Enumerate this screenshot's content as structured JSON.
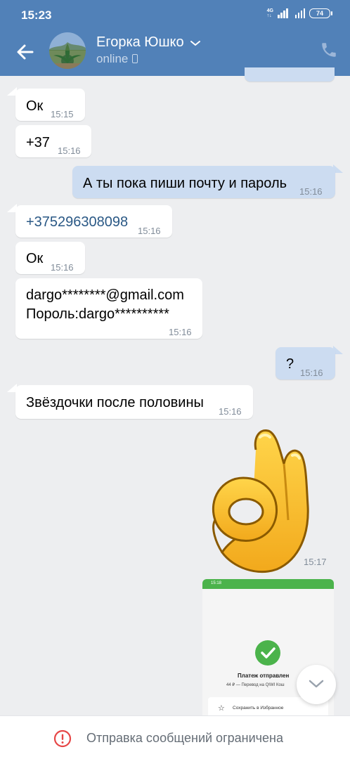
{
  "status_bar": {
    "time": "15:23",
    "network": "4G",
    "battery": "74"
  },
  "header": {
    "contact_name": "Егорка Юшко",
    "status": "online",
    "back_icon": "arrow-left-icon",
    "call_icon": "phone-icon",
    "dropdown_icon": "chevron-down-icon",
    "bg_color": "#5181b8"
  },
  "messages": [
    {
      "dir": "in",
      "text": "Ок",
      "time": "15:15"
    },
    {
      "dir": "in",
      "text": "+37",
      "time": "15:16"
    },
    {
      "dir": "out",
      "text": "А ты пока пиши почту и пароль",
      "time": "15:16"
    },
    {
      "dir": "in",
      "text": "+375296308098",
      "time": "15:16",
      "link": true
    },
    {
      "dir": "in",
      "text": "Ок",
      "time": "15:16"
    },
    {
      "dir": "in",
      "line1": "dargo********@gmail.com",
      "line2": "Пороль:dargo**********",
      "time": "15:16"
    },
    {
      "dir": "out",
      "text": "?",
      "time": "15:16"
    },
    {
      "dir": "in",
      "text": "Звёздочки после половины",
      "time": "15:16"
    }
  ],
  "sticker": {
    "icon": "ok-hand-sticker",
    "time": "15:17"
  },
  "attachment_preview": {
    "status_time": "15:18",
    "title": "Платеж отправлен",
    "subtitle": "44 ₽ — Перевод на QIWI Кош",
    "save_label": "Сохранить в Избранное",
    "accent": "#4bb34b"
  },
  "scroll_button": {
    "icon": "chevron-down-icon"
  },
  "bottom_bar": {
    "text": "Отправка сообщений ограничена",
    "icon": "exclamation-circle-icon",
    "icon_color": "#e64646"
  }
}
